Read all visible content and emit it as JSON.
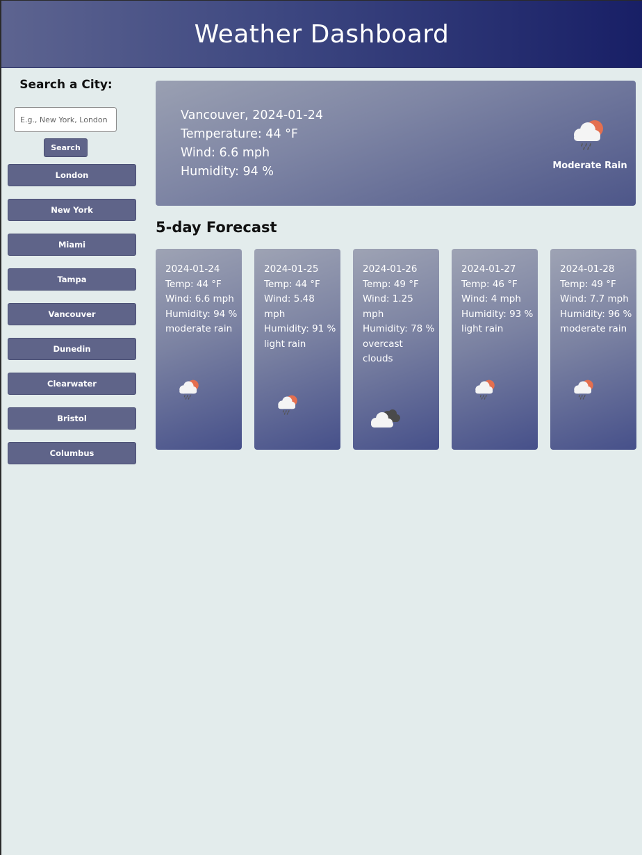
{
  "header": {
    "title": "Weather Dashboard"
  },
  "sidebar": {
    "search_title": "Search a City:",
    "search_placeholder": "E.g., New York, London",
    "search_button": "Search",
    "cities": [
      "London",
      "New York",
      "Miami",
      "Tampa",
      "Vancouver",
      "Dunedin",
      "Clearwater",
      "Bristol",
      "Columbus"
    ]
  },
  "current": {
    "city_date": "Vancouver, 2024-01-24",
    "temperature": "Temperature: 44 °F",
    "wind": "Wind: 6.6 mph",
    "humidity": "Humidity: 94 %",
    "description": "Moderate Rain",
    "icon": "rain-sun-icon"
  },
  "forecast": {
    "title": "5-day Forecast",
    "days": [
      {
        "date": "2024-01-24",
        "temp": "Temp: 44 °F",
        "wind": "Wind: 6.6 mph",
        "humidity": "Humidity: 94 %",
        "desc": "moderate rain",
        "icon": "rain-sun-icon"
      },
      {
        "date": "2024-01-25",
        "temp": "Temp: 44 °F",
        "wind": "Wind: 5.48 mph",
        "humidity": "Humidity: 91 %",
        "desc": "light rain",
        "icon": "rain-sun-icon"
      },
      {
        "date": "2024-01-26",
        "temp": "Temp: 49 °F",
        "wind": "Wind: 1.25 mph",
        "humidity": "Humidity: 78 %",
        "desc": "overcast clouds",
        "icon": "overcast-clouds-icon"
      },
      {
        "date": "2024-01-27",
        "temp": "Temp: 46 °F",
        "wind": "Wind: 4 mph",
        "humidity": "Humidity: 93 %",
        "desc": "light rain",
        "icon": "rain-sun-icon"
      },
      {
        "date": "2024-01-28",
        "temp": "Temp: 49 °F",
        "wind": "Wind: 7.7 mph",
        "humidity": "Humidity: 96 %",
        "desc": "moderate rain",
        "icon": "rain-sun-icon"
      }
    ]
  },
  "colors": {
    "page_bg": "#e3ecec",
    "button": "#5f6489",
    "header_start": "#5d6490",
    "header_end": "#181f66",
    "sun": "#e46f4f"
  }
}
